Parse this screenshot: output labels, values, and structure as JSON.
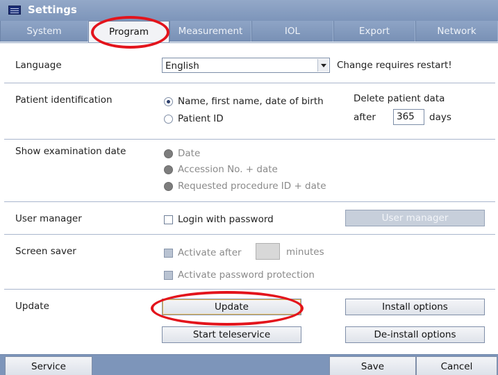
{
  "window": {
    "title": "Settings"
  },
  "tabs": [
    {
      "label": "System"
    },
    {
      "label": "Program"
    },
    {
      "label": "Measurement"
    },
    {
      "label": "IOL"
    },
    {
      "label": "Export"
    },
    {
      "label": "Network"
    }
  ],
  "active_tab": "Program",
  "language": {
    "label": "Language",
    "value": "English",
    "note": "Change requires restart!"
  },
  "patient_identification": {
    "label": "Patient identification",
    "options": [
      {
        "label": "Name, first name, date of birth",
        "selected": true
      },
      {
        "label": "Patient ID",
        "selected": false
      }
    ],
    "delete_title": "Delete patient data",
    "after_label": "after",
    "days_value": "365",
    "days_label": "days"
  },
  "examination_date": {
    "label": "Show examination date",
    "options": [
      {
        "label": "Date"
      },
      {
        "label": "Accession No. + date"
      },
      {
        "label": "Requested procedure ID + date"
      }
    ]
  },
  "user_manager": {
    "label": "User manager",
    "login_label": "Login with password",
    "login_checked": false,
    "button_label": "User manager"
  },
  "screen_saver": {
    "label": "Screen saver",
    "activate_label": "Activate after",
    "minutes_value": "",
    "minutes_label": "minutes",
    "password_label": "Activate password protection"
  },
  "update": {
    "label": "Update",
    "update_button": "Update",
    "teleservice_button": "Start teleservice",
    "install_button": "Install options",
    "deinstall_button": "De-install options"
  },
  "footer": {
    "service_button": "Service",
    "save_button": "Save",
    "cancel_button": "Cancel"
  },
  "colors": {
    "title_bar": "#7d95ba",
    "annotation": "#e3141c"
  }
}
